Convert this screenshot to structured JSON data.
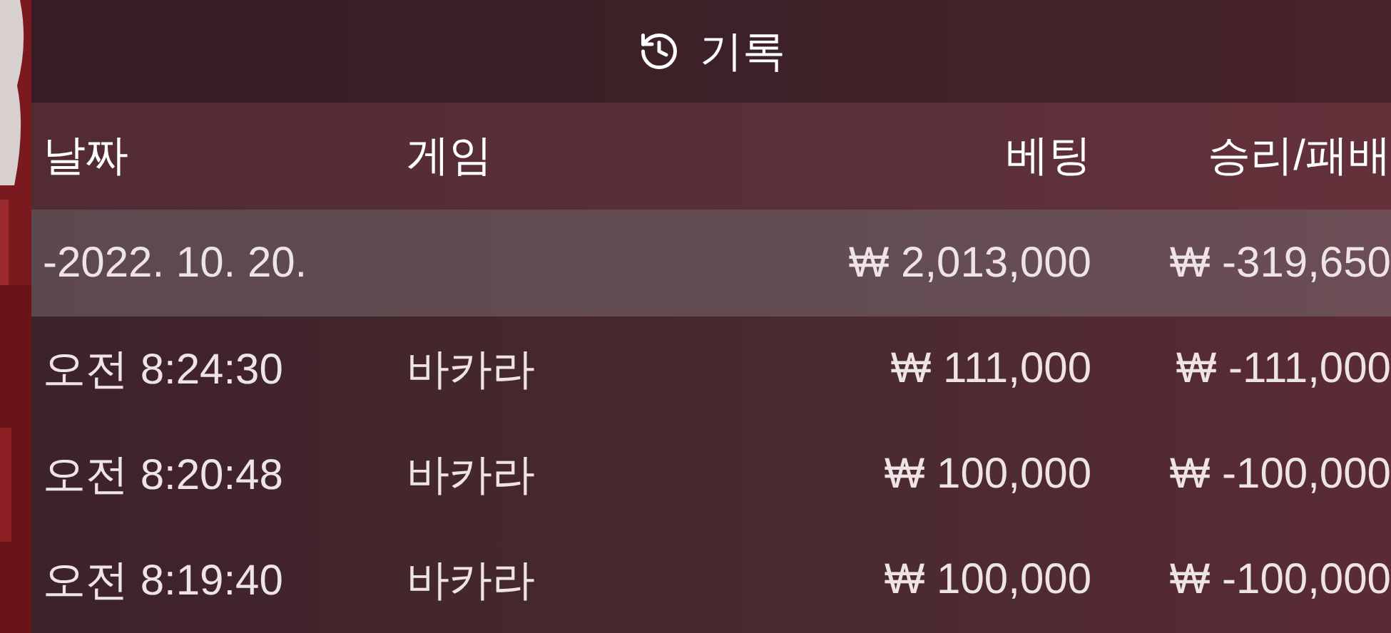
{
  "title": "기록",
  "columns": [
    "날짜",
    "게임",
    "베팅",
    "승리/패배"
  ],
  "summary": {
    "date": "-2022. 10. 20.",
    "bet": "₩ 2,013,000",
    "result": "₩ -319,650"
  },
  "rows": [
    {
      "time": "오전 8:24:30",
      "game": "바카라",
      "bet": "₩ 111,000",
      "result": "₩ -111,000"
    },
    {
      "time": "오전 8:20:48",
      "game": "바카라",
      "bet": "₩ 100,000",
      "result": "₩ -100,000"
    },
    {
      "time": "오전 8:19:40",
      "game": "바카라",
      "bet": "₩ 100,000",
      "result": "₩ -100,000"
    }
  ]
}
